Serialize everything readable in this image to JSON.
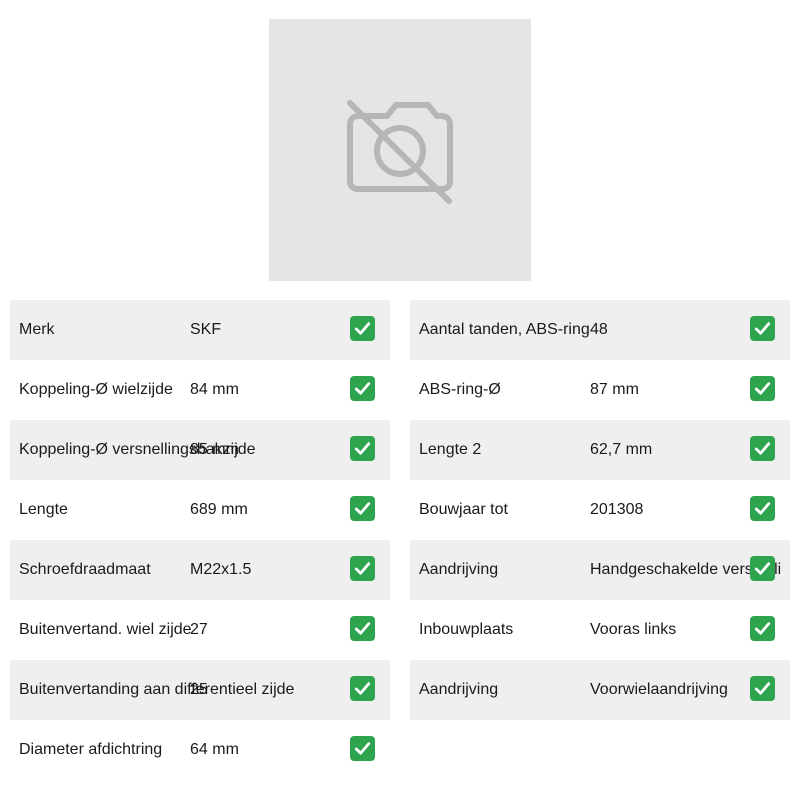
{
  "product_image": {
    "icon": "no-photo-icon",
    "background": "#e5e5e5",
    "icon_color": "#b6b6b6"
  },
  "colors": {
    "row_shaded": "#efefef",
    "check": "#2ea44f"
  },
  "specs": {
    "left": [
      {
        "label": "Merk",
        "value": "SKF",
        "icon": "check-mark-icon"
      },
      {
        "label": "Koppeling-Ø wielzijde",
        "value": "84 mm",
        "icon": "check-mark-icon"
      },
      {
        "label": "Koppeling-Ø versnellingsbakzijde",
        "value": "85 mm",
        "icon": "check-mark-icon"
      },
      {
        "label": "Lengte",
        "value": "689 mm",
        "icon": "check-mark-icon"
      },
      {
        "label": "Schroefdraadmaat",
        "value": "M22x1.5",
        "icon": "check-mark-icon"
      },
      {
        "label": "Buitenvertand. wiel zijde",
        "value": "27",
        "icon": "check-mark-icon"
      },
      {
        "label": "Buitenvertanding aan differentieel zijde",
        "value": "25",
        "icon": "check-mark-icon"
      },
      {
        "label": "Diameter afdichtring",
        "value": "64 mm",
        "icon": "check-mark-icon"
      }
    ],
    "right": [
      {
        "label": "Aantal tanden, ABS-ring",
        "value": "48",
        "icon": "check-mark-icon"
      },
      {
        "label": "ABS-ring-Ø",
        "value": "87 mm",
        "icon": "check-mark-icon"
      },
      {
        "label": "Lengte 2",
        "value": "62,7 mm",
        "icon": "check-mark-icon"
      },
      {
        "label": "Bouwjaar tot",
        "value": "201308",
        "icon": "check-mark-icon"
      },
      {
        "label": "Aandrijving",
        "value": "Handgeschakelde versnelli",
        "icon": "check-mark-icon"
      },
      {
        "label": "Inbouwplaats",
        "value": "Vooras links",
        "icon": "check-mark-icon"
      },
      {
        "label": "Aandrijving",
        "value": "Voorwielaandrijving",
        "icon": "check-mark-icon"
      }
    ]
  }
}
